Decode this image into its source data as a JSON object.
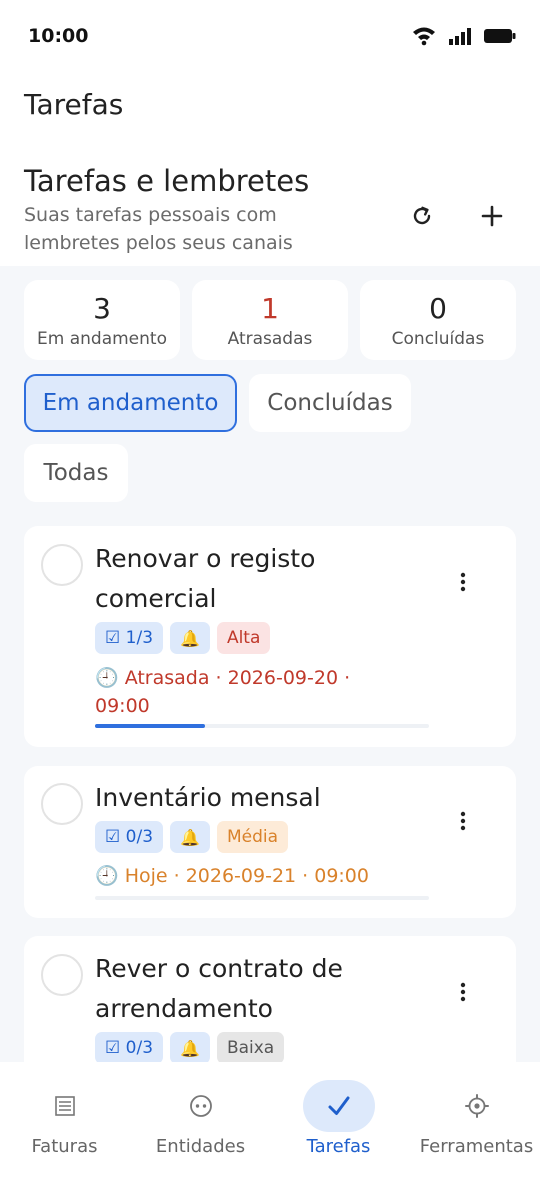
{
  "status_bar": {
    "time": "10:00"
  },
  "app_bar": {
    "title": "Tarefas"
  },
  "header": {
    "title": "Tarefas e lembretes",
    "subtitle": "Suas tarefas pessoais com lembretes pelos seus canais",
    "refresh_icon": "refresh-icon",
    "add_icon": "plus-icon"
  },
  "stats": [
    {
      "value": "3",
      "label": "Em andamento"
    },
    {
      "value": "1",
      "label": "Atrasadas"
    },
    {
      "value": "0",
      "label": "Concluídas"
    }
  ],
  "filters": [
    {
      "label": "Em andamento",
      "selected": true
    },
    {
      "label": "Concluídas",
      "selected": false
    },
    {
      "label": "Todas",
      "selected": false
    }
  ],
  "tasks": [
    {
      "title": "Renovar o registo comercial",
      "checklist": "☑ 1/3",
      "reminder_icon": "bell-icon",
      "priority": "Alta",
      "due": "🕘 Atrasada · 2026-09-20 · 09:00",
      "progress": 0.33
    },
    {
      "title": "Inventário mensal",
      "checklist": "☑ 0/3",
      "reminder_icon": "bell-icon",
      "priority": "Média",
      "due": "🕘 Hoje · 2026-09-21 · 09:00",
      "progress": 0
    },
    {
      "title": "Rever o contrato de arrendamento",
      "checklist": "☑ 0/3",
      "reminder_icon": "bell-icon",
      "priority": "Baixa"
    }
  ],
  "bottom_nav": [
    {
      "label": "Faturas",
      "icon": "invoice-icon",
      "active": false
    },
    {
      "label": "Entidades",
      "icon": "entity-icon",
      "active": false
    },
    {
      "label": "Tarefas",
      "icon": "check-icon",
      "active": true
    },
    {
      "label": "Ferramentas",
      "icon": "gear-icon",
      "active": false
    }
  ],
  "colors": {
    "accent": "#2f6fde",
    "overdue": "#c0392b",
    "today": "#d9822b"
  }
}
